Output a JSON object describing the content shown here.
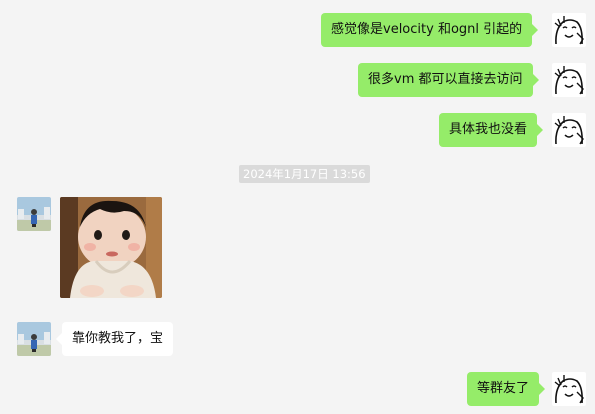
{
  "messages": [
    {
      "sender": "self",
      "text": "感觉像是velocity 和ognl 引起的"
    },
    {
      "sender": "self",
      "text": "很多vm 都可以直接去访问"
    },
    {
      "sender": "self",
      "text": "具体我也没看"
    },
    {
      "sender": "other",
      "type": "image"
    },
    {
      "sender": "other",
      "text": "靠你教我了，宝"
    },
    {
      "sender": "self",
      "text": "等群友了"
    }
  ],
  "timestamp": "2024年1月17日 13:56",
  "colors": {
    "background": "#f4f4f4",
    "self_bubble": "#95ec69",
    "other_bubble": "#ffffff",
    "timestamp_bg": "#dadada"
  },
  "icons": {
    "self_avatar": "cartoon-face-avatar",
    "other_avatar": "landscape-photo-avatar",
    "image_message": "baby-photo"
  }
}
